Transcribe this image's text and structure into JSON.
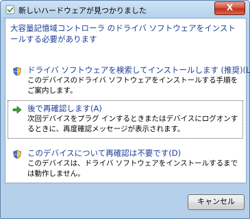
{
  "dialog": {
    "title": "新しいハードウェアが見つかりました",
    "close_label": "X",
    "heading": "大容量記憶域コントローラ のドライバ ソフトウェアをインストールする必要があります"
  },
  "options": [
    {
      "title": "ドライバ ソフトウェアを検索してインストールします (推奨)(L)",
      "description": "このデバイスのドライバ ソフトウェアをインストールする手順をご案内します。",
      "icon": "shield-icon"
    },
    {
      "title": "後で再確認します(A)",
      "description": "次回デバイスをプラグ インするときまたはデバイスにログオンするときに、再度確認メッセージが表示されます。",
      "icon": "green-arrow-icon"
    },
    {
      "title": "このデバイスについて再確認は不要です(D)",
      "description": "このデバイスは、ドライバ ソフトウェアをインストールするまでは動作しません。",
      "icon": "shield-icon"
    }
  ],
  "footer": {
    "cancel_label": "キャンセル"
  },
  "colors": {
    "link_blue": "#1a3d96",
    "window_frame": "#b4d0eb",
    "close_red": "#c2301b"
  }
}
